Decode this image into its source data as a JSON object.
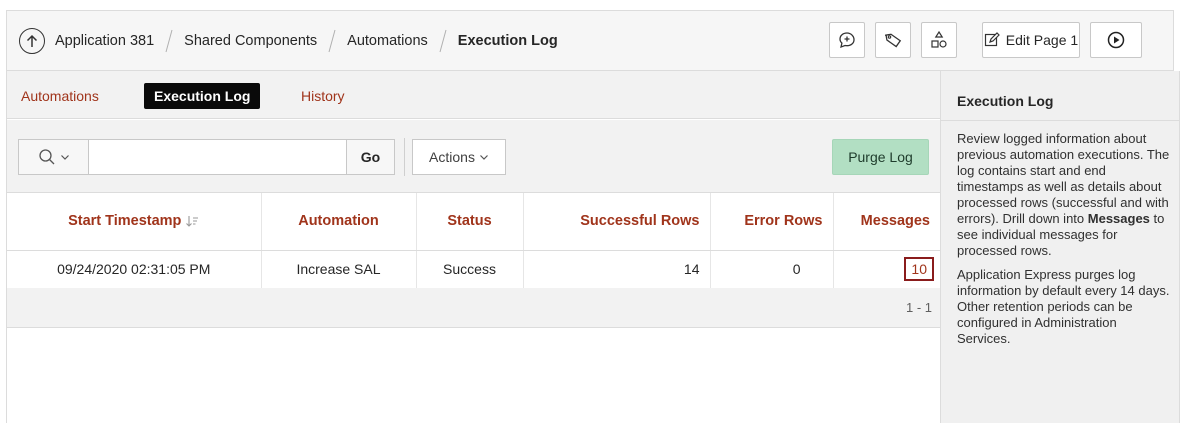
{
  "breadcrumb": {
    "items": [
      "Application 381",
      "Shared Components",
      "Automations",
      "Execution Log"
    ]
  },
  "toolbar_buttons": {
    "edit_page_label": "Edit Page 1"
  },
  "tabs": [
    {
      "label": "Automations"
    },
    {
      "label": "Execution Log"
    },
    {
      "label": "History"
    }
  ],
  "search": {
    "value": "",
    "placeholder": "",
    "go_label": "Go"
  },
  "actions_label": "Actions",
  "purge_label": "Purge Log",
  "table": {
    "columns": [
      "Start Timestamp",
      "Automation",
      "Status",
      "Successful Rows",
      "Error Rows",
      "Messages"
    ],
    "rows": [
      {
        "start_timestamp": "09/24/2020 02:31:05 PM",
        "automation": "Increase SAL",
        "status": "Success",
        "successful_rows": "14",
        "error_rows": "0",
        "messages": "10"
      }
    ]
  },
  "pagination": "1 - 1",
  "help": {
    "title": "Execution Log",
    "p1_a": "Review logged information about previous automation executions. The log contains start and end timestamps as well as details about processed rows (successful and with errors). Drill down into ",
    "p1_bold": "Messages",
    "p1_b": " to see individual messages for processed rows.",
    "p2": "Application Express purges log information by default every 14 days. Other retention periods can be configured in Administration Services."
  },
  "colors": {
    "link": "#a0341b",
    "active_tab_bg": "#0a0a0a",
    "purge_bg": "#b2dfc3",
    "highlight_border": "#8a1c1c"
  }
}
